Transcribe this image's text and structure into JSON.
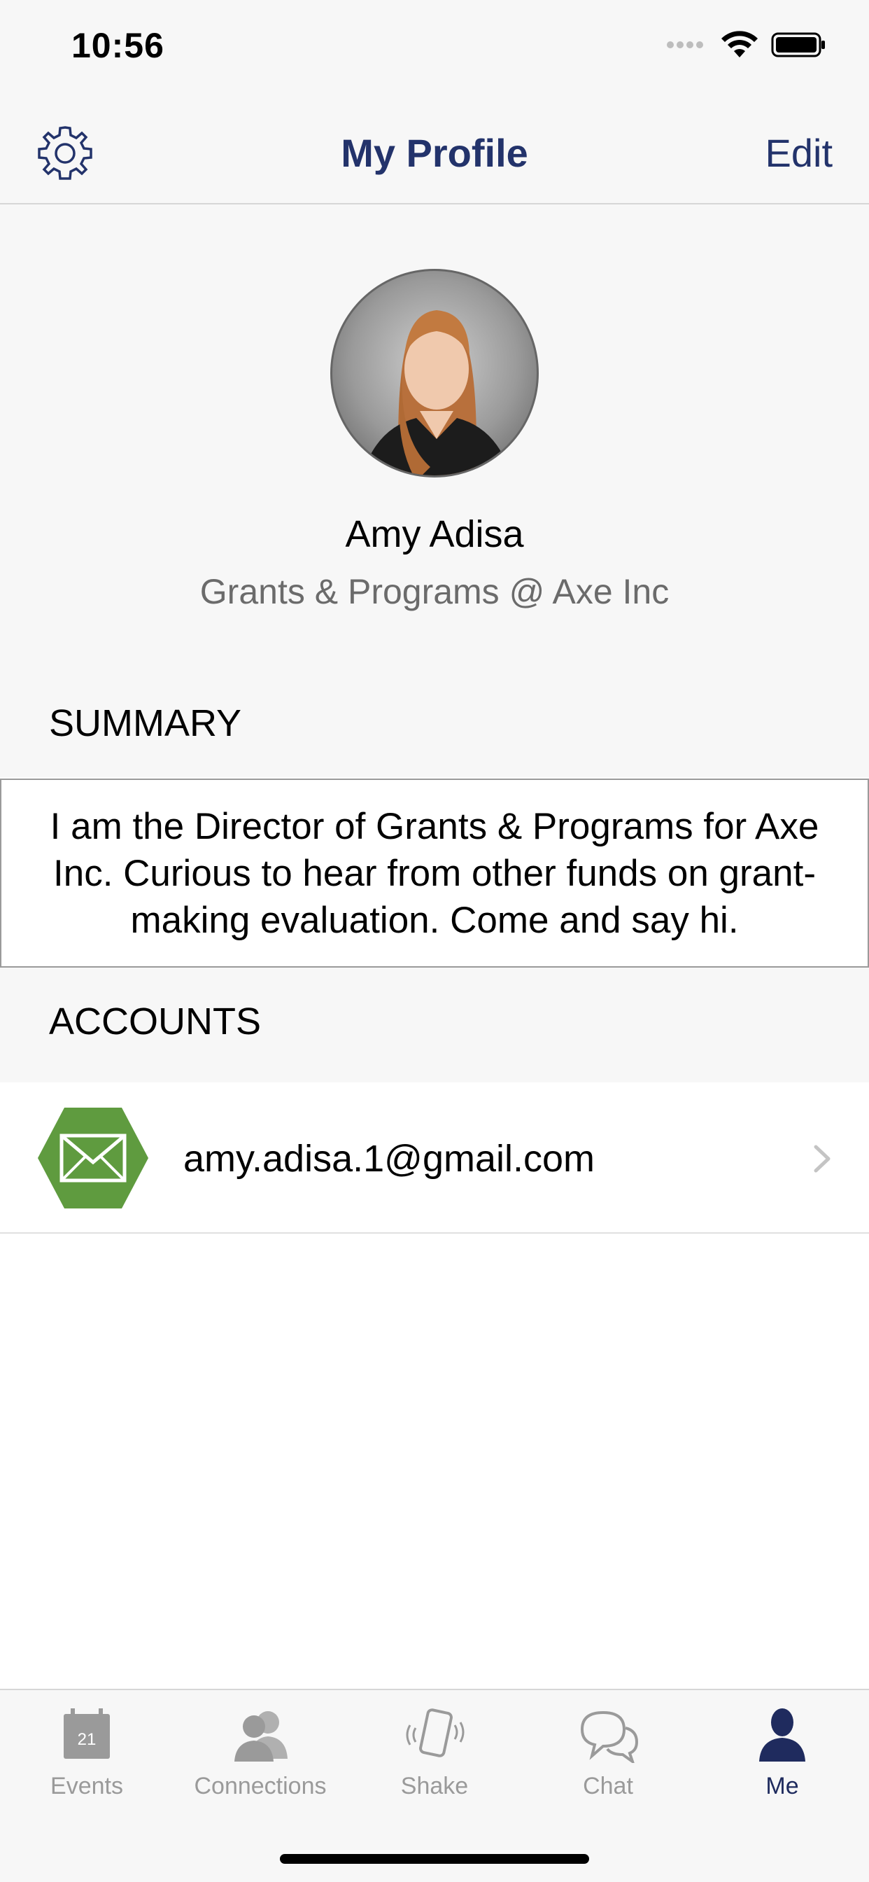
{
  "status_bar": {
    "time": "10:56"
  },
  "nav": {
    "title": "My Profile",
    "edit_label": "Edit"
  },
  "profile": {
    "name": "Amy Adisa",
    "role": "Grants & Programs @ Axe Inc"
  },
  "summary": {
    "header": "SUMMARY",
    "text": "I am the Director of Grants & Programs for Axe Inc. Curious to hear from other funds on grant-making evaluation. Come and say hi."
  },
  "accounts": {
    "header": "ACCOUNTS",
    "items": [
      {
        "icon": "mail-icon",
        "email": "amy.adisa.1@gmail.com"
      }
    ]
  },
  "tabs": [
    {
      "label": "Events",
      "icon": "calendar-icon",
      "badge": "21"
    },
    {
      "label": "Connections",
      "icon": "people-icon"
    },
    {
      "label": "Shake",
      "icon": "shake-phone-icon"
    },
    {
      "label": "Chat",
      "icon": "chat-icon"
    },
    {
      "label": "Me",
      "icon": "person-icon",
      "active": true
    }
  ],
  "colors": {
    "accent": "#23336b",
    "mail_green": "#5f9b3f",
    "inactive_tab": "#9a9a9a"
  }
}
